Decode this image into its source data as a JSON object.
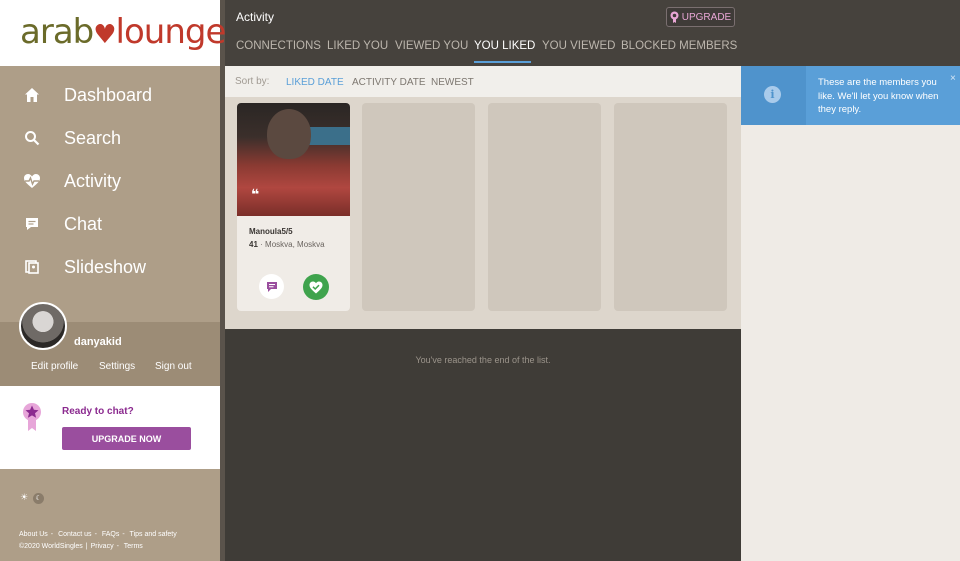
{
  "brand": {
    "logo_part1": "arab",
    "logo_part2": "lounge"
  },
  "sidebar": {
    "items": [
      {
        "label": "Dashboard",
        "icon": "home-icon"
      },
      {
        "label": "Search",
        "icon": "search-icon"
      },
      {
        "label": "Activity",
        "icon": "heartbeat-icon"
      },
      {
        "label": "Chat",
        "icon": "chat-icon"
      },
      {
        "label": "Slideshow",
        "icon": "slideshow-icon"
      }
    ]
  },
  "profile": {
    "username": "danyakid",
    "edit_profile": "Edit profile",
    "settings": "Settings",
    "sign_out": "Sign out"
  },
  "promo": {
    "ready_text": "Ready to chat?",
    "button": "UPGRADE NOW"
  },
  "footer": {
    "about": "About Us",
    "contact": "Contact us",
    "faqs": "FAQs",
    "tips": "Tips and safety",
    "copyright": "©2020 WorldSingles",
    "privacy": "Privacy",
    "terms": "Terms"
  },
  "activity": {
    "title": "Activity",
    "upgrade": "UPGRADE",
    "tabs": [
      "CONNECTIONS",
      "LIKED YOU",
      "VIEWED YOU",
      "YOU LIKED",
      "YOU VIEWED",
      "BLOCKED MEMBERS"
    ],
    "active_tab": "YOU LIKED",
    "sort_label": "Sort by:",
    "sort_options": [
      "LIKED DATE",
      "ACTIVITY DATE",
      "NEWEST"
    ],
    "active_sort": "LIKED DATE",
    "end_text": "You've reached the end of the list."
  },
  "member_card": {
    "name": "Manoula5/5",
    "age": "41",
    "location": "Moskva, Moskva",
    "quote": "❝"
  },
  "tooltip": {
    "text": "These are the members you like. We'll let you know when they reply.",
    "info": "i",
    "close": "×"
  },
  "colors": {
    "sidebar": "#ae9e88",
    "panel": "#3f3c37",
    "accent_blue": "#5a9fd8",
    "like_green": "#3fa34d",
    "upgrade_purple": "#9a4e9e"
  }
}
